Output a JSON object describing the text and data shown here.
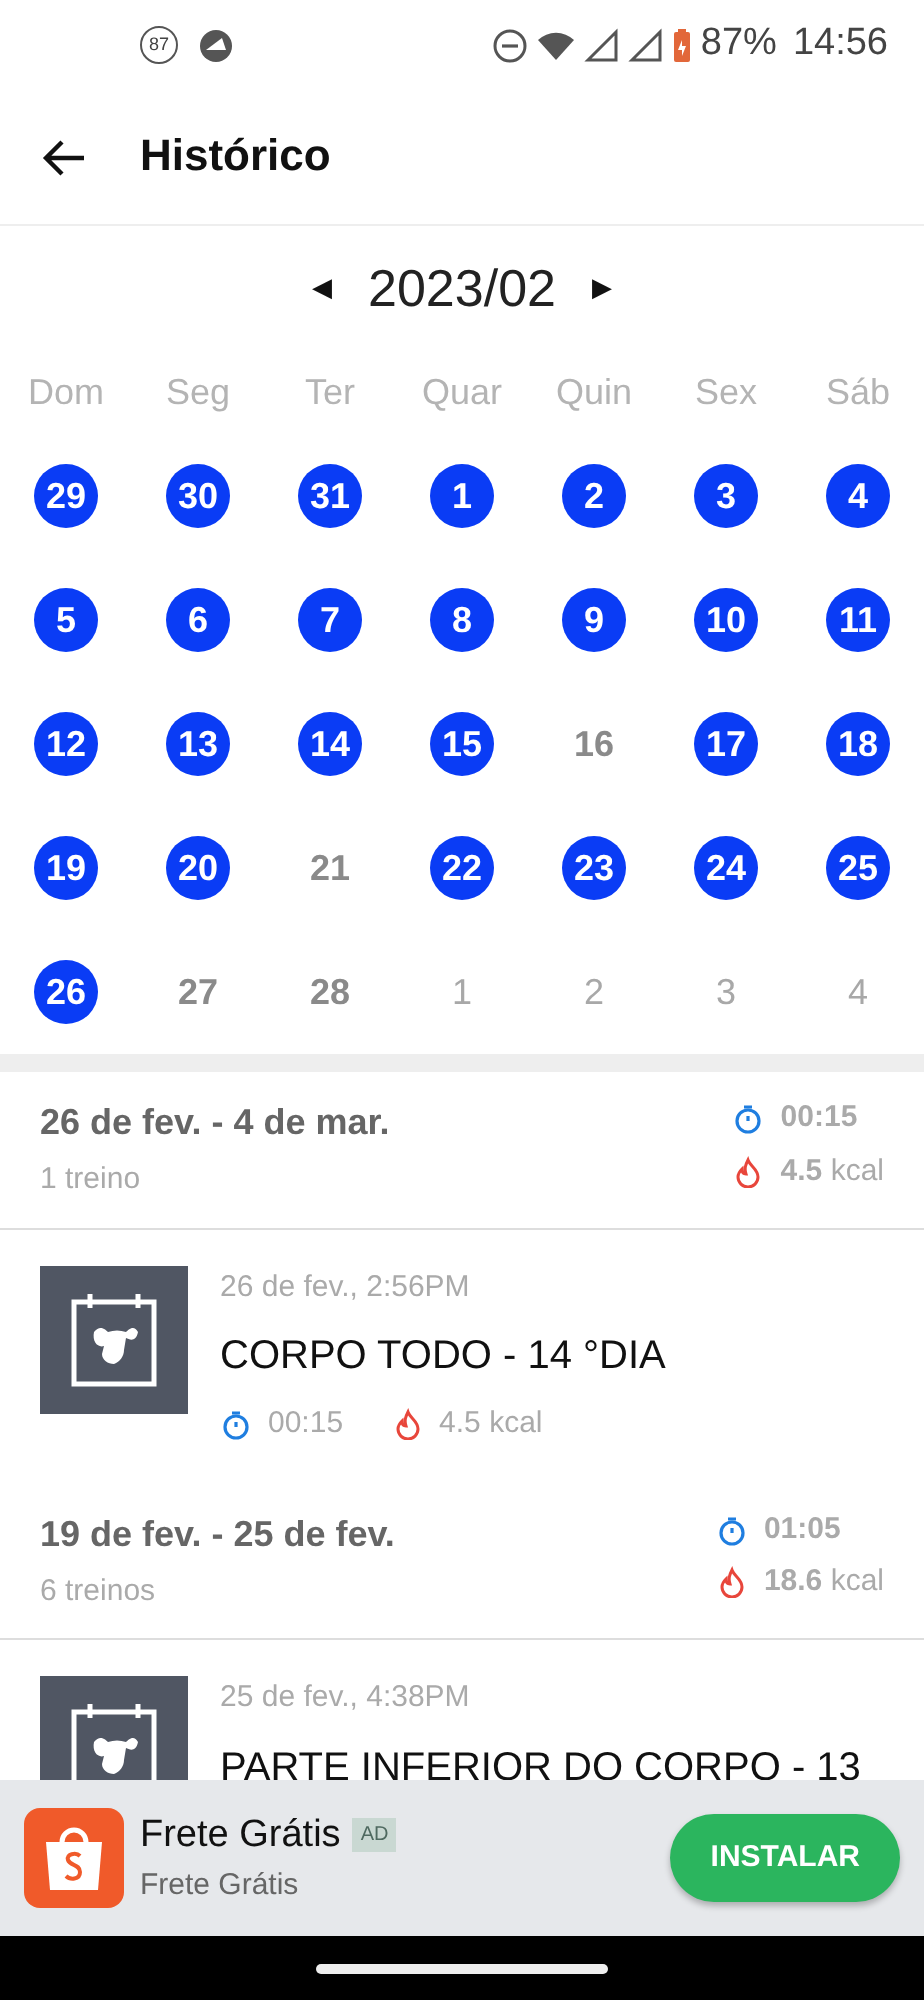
{
  "status_bar": {
    "notification_count": "87",
    "battery": "87%",
    "time": "14:56"
  },
  "app_bar": {
    "title": "Histórico"
  },
  "calendar": {
    "previous": "◀",
    "month": "2023/02",
    "next": "▶",
    "weekdays": [
      "Dom",
      "Seg",
      "Ter",
      "Quar",
      "Quin",
      "Sex",
      "Sáb"
    ],
    "days": [
      {
        "label": "29",
        "done": true,
        "in_month": false
      },
      {
        "label": "30",
        "done": true,
        "in_month": false
      },
      {
        "label": "31",
        "done": true,
        "in_month": false
      },
      {
        "label": "1",
        "done": true,
        "in_month": true
      },
      {
        "label": "2",
        "done": true,
        "in_month": true
      },
      {
        "label": "3",
        "done": true,
        "in_month": true
      },
      {
        "label": "4",
        "done": true,
        "in_month": true
      },
      {
        "label": "5",
        "done": true,
        "in_month": true
      },
      {
        "label": "6",
        "done": true,
        "in_month": true
      },
      {
        "label": "7",
        "done": true,
        "in_month": true
      },
      {
        "label": "8",
        "done": true,
        "in_month": true
      },
      {
        "label": "9",
        "done": true,
        "in_month": true
      },
      {
        "label": "10",
        "done": true,
        "in_month": true
      },
      {
        "label": "11",
        "done": true,
        "in_month": true
      },
      {
        "label": "12",
        "done": true,
        "in_month": true
      },
      {
        "label": "13",
        "done": true,
        "in_month": true
      },
      {
        "label": "14",
        "done": true,
        "in_month": true
      },
      {
        "label": "15",
        "done": true,
        "in_month": true
      },
      {
        "label": "16",
        "done": false,
        "in_month": true
      },
      {
        "label": "17",
        "done": true,
        "in_month": true
      },
      {
        "label": "18",
        "done": true,
        "in_month": true
      },
      {
        "label": "19",
        "done": true,
        "in_month": true
      },
      {
        "label": "20",
        "done": true,
        "in_month": true
      },
      {
        "label": "21",
        "done": false,
        "in_month": true
      },
      {
        "label": "22",
        "done": true,
        "in_month": true
      },
      {
        "label": "23",
        "done": true,
        "in_month": true
      },
      {
        "label": "24",
        "done": true,
        "in_month": true
      },
      {
        "label": "25",
        "done": true,
        "in_month": true
      },
      {
        "label": "26",
        "done": true,
        "in_month": true
      },
      {
        "label": "27",
        "done": false,
        "in_month": true
      },
      {
        "label": "28",
        "done": false,
        "in_month": true
      },
      {
        "label": "1",
        "done": false,
        "in_month": false
      },
      {
        "label": "2",
        "done": false,
        "in_month": false
      },
      {
        "label": "3",
        "done": false,
        "in_month": false
      },
      {
        "label": "4",
        "done": false,
        "in_month": false
      }
    ]
  },
  "history": [
    {
      "kind": "week",
      "range": "26 de fev. - 4 de mar.",
      "count": "1 treino",
      "duration": "00:15",
      "kcal_value": "4.5",
      "kcal_unit": "kcal"
    },
    {
      "kind": "workout",
      "datetime": "26 de fev., 2:56PM",
      "title": "CORPO TODO - 14 °DIA",
      "duration": "00:15",
      "kcal": "4.5 kcal"
    },
    {
      "kind": "week",
      "range": "19 de fev. - 25 de fev.",
      "count": "6 treinos",
      "duration": "01:05",
      "kcal_value": "18.6",
      "kcal_unit": "kcal"
    },
    {
      "kind": "workout",
      "datetime": "25 de fev., 4:38PM",
      "title": "PARTE INFERIOR DO CORPO - 13"
    }
  ],
  "ad": {
    "title": "Frete Grátis",
    "badge": "AD",
    "subtitle": "Frete Grátis",
    "button": "INSTALAR"
  }
}
